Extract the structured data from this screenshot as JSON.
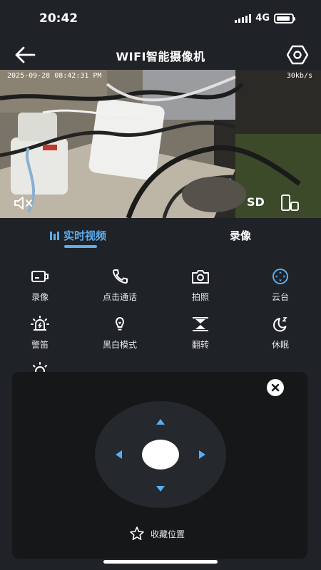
{
  "status_bar": {
    "time": "20:42",
    "network": "4G",
    "battery_level": 0.9
  },
  "header": {
    "title": "WIFI智能摄像机",
    "back_icon": "arrow-left-icon",
    "settings_icon": "hexagon-settings-icon"
  },
  "video": {
    "osd_timestamp": "2025-09-28 08:42:31 PM",
    "bitrate": "30kb/s",
    "sd_label": "SD",
    "mute_icon": "speaker-muted-icon",
    "rotate_icon": "screen-rotate-icon"
  },
  "tabs": {
    "live_label": "实时视频",
    "record_label": "录像",
    "active": "live",
    "accent_color": "#5aaef0"
  },
  "functions": [
    {
      "label": "录像",
      "icon": "video-record-icon"
    },
    {
      "label": "点击通话",
      "icon": "phone-icon"
    },
    {
      "label": "拍照",
      "icon": "camera-icon"
    },
    {
      "label": "云台",
      "icon": "ptz-icon",
      "active": true
    },
    {
      "label": "警笛",
      "icon": "siren-icon"
    },
    {
      "label": "黑白模式",
      "icon": "lightbulb-icon"
    },
    {
      "label": "翻转",
      "icon": "flip-icon"
    },
    {
      "label": "休眠",
      "icon": "moon-sleep-icon"
    },
    {
      "label": "",
      "icon": "light-icon"
    }
  ],
  "ptz": {
    "favorite_label": "收藏位置",
    "close_icon": "close-icon",
    "star_icon": "star-outline-icon"
  }
}
